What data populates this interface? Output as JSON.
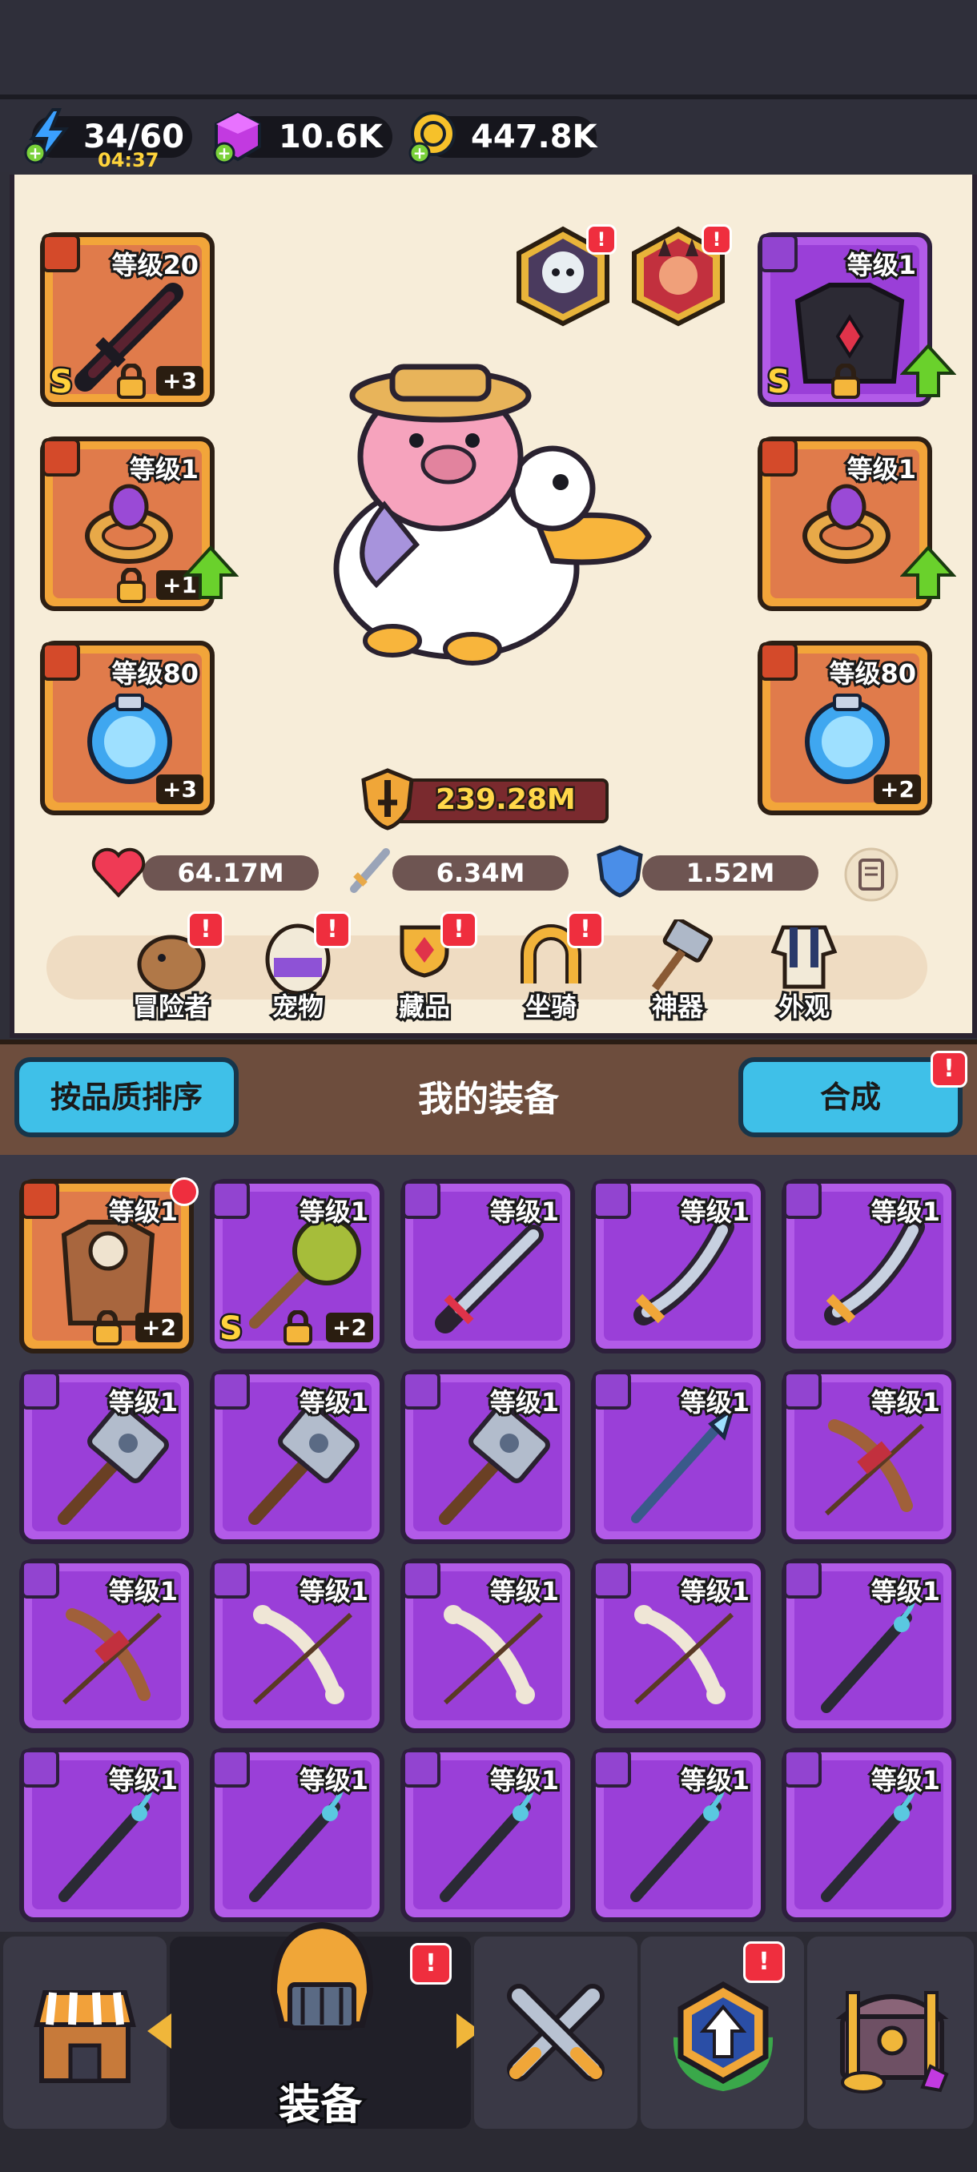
{
  "resources": {
    "energy": {
      "value": "34/60",
      "timer": "04:37"
    },
    "gems": {
      "value": "10.6K"
    },
    "gold": {
      "value": "447.8K"
    }
  },
  "hero": {
    "power": "239.28M",
    "stats": {
      "hp": "64.17M",
      "attack": "6.34M",
      "defense": "1.52M"
    }
  },
  "equipped": {
    "left": [
      {
        "level": "等级20",
        "plus": "+3",
        "rarity": "S",
        "locked": true,
        "type": "sword"
      },
      {
        "level": "等级1",
        "plus": "+1",
        "locked": true,
        "type": "ring",
        "upgrade": true
      },
      {
        "level": "等级80",
        "plus": "+3",
        "type": "orb"
      }
    ],
    "right": [
      {
        "level": "等级1",
        "rarity": "S",
        "locked": true,
        "type": "armor",
        "upgrade": true
      },
      {
        "level": "等级1",
        "type": "ring",
        "upgrade": true
      },
      {
        "level": "等级80",
        "plus": "+2",
        "type": "orb"
      }
    ]
  },
  "tabs": [
    {
      "label": "冒险者",
      "alert": "!"
    },
    {
      "label": "宠物",
      "alert": "!"
    },
    {
      "label": "藏品",
      "alert": "!"
    },
    {
      "label": "坐骑",
      "alert": "!"
    },
    {
      "label": "神器"
    },
    {
      "label": "外观"
    }
  ],
  "equipment_header": {
    "sort_button": "按品质排序",
    "title": "我的装备",
    "merge_button": "合成",
    "merge_alert": "!"
  },
  "inventory": [
    {
      "level": "等级1",
      "plus": "+2",
      "color": "orange",
      "type": "armor",
      "locked": true
    },
    {
      "level": "等级1",
      "plus": "+2",
      "color": "purple",
      "type": "mace",
      "rarity": "S",
      "locked": true
    },
    {
      "level": "等级1",
      "color": "purple",
      "type": "blade"
    },
    {
      "level": "等级1",
      "color": "purple",
      "type": "saber"
    },
    {
      "level": "等级1",
      "color": "purple",
      "type": "saber"
    },
    {
      "level": "等级1",
      "color": "purple",
      "type": "hammer"
    },
    {
      "level": "等级1",
      "color": "purple",
      "type": "hammer"
    },
    {
      "level": "等级1",
      "color": "purple",
      "type": "hammer"
    },
    {
      "level": "等级1",
      "color": "purple",
      "type": "spear"
    },
    {
      "level": "等级1",
      "color": "purple",
      "type": "bow"
    },
    {
      "level": "等级1",
      "color": "purple",
      "type": "bow"
    },
    {
      "level": "等级1",
      "color": "purple",
      "type": "bonebow"
    },
    {
      "level": "等级1",
      "color": "purple",
      "type": "bonebow"
    },
    {
      "level": "等级1",
      "color": "purple",
      "type": "bonebow"
    },
    {
      "level": "等级1",
      "color": "purple",
      "type": "staff"
    },
    {
      "level": "等级1",
      "color": "purple",
      "type": "staff"
    },
    {
      "level": "等级1",
      "color": "purple",
      "type": "staff"
    },
    {
      "level": "等级1",
      "color": "purple",
      "type": "staff"
    },
    {
      "level": "等级1",
      "color": "purple",
      "type": "staff"
    },
    {
      "level": "等级1",
      "color": "purple",
      "type": "staff"
    }
  ],
  "bottom_nav": {
    "active_label": "装备",
    "equip_alert": "!",
    "upgrade_alert": "!"
  },
  "colors": {
    "purple_slot": "#9a3fd8",
    "orange_slot": "#e07b4b",
    "cyan_button": "#3fc0e8",
    "alert_red": "#ef2e3e"
  }
}
